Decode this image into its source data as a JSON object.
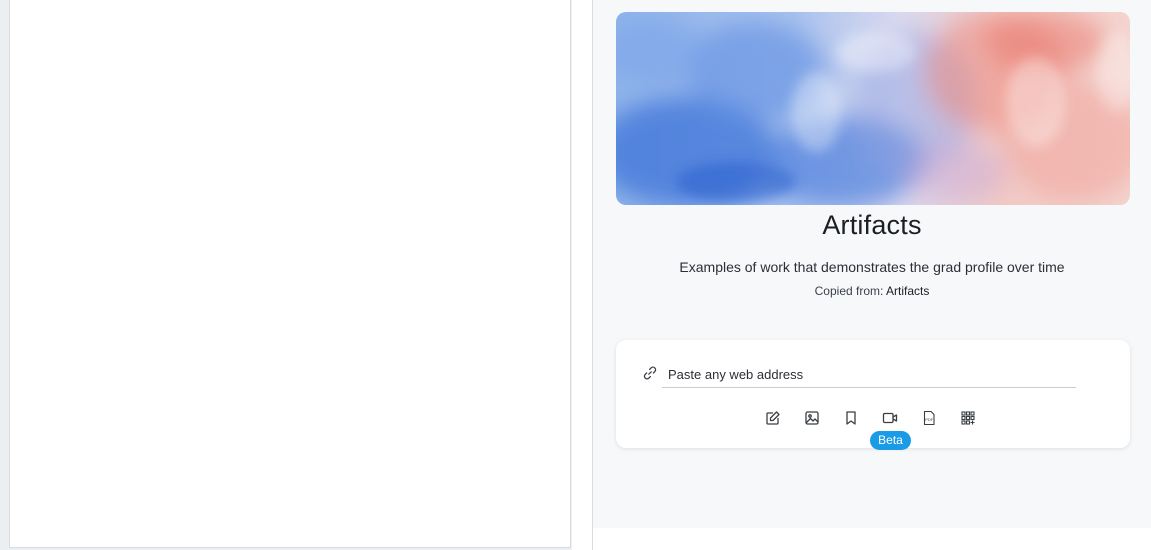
{
  "artifact": {
    "title": "Artifacts",
    "description": "Examples of work that demonstrates the grad profile over time",
    "copied_from_label": "Copied from:",
    "copied_from_name": "Artifacts"
  },
  "add_item": {
    "url_placeholder": "Paste any web address",
    "tools": [
      {
        "icon": "edit-icon"
      },
      {
        "icon": "image-icon"
      },
      {
        "icon": "bookmark-icon"
      },
      {
        "icon": "video-icon"
      },
      {
        "icon": "pdf-icon"
      },
      {
        "icon": "qr-code-icon"
      }
    ],
    "beta_label": "Beta"
  },
  "colors": {
    "accent": "#1a9be6",
    "panel_background": "#f6f8fa"
  }
}
